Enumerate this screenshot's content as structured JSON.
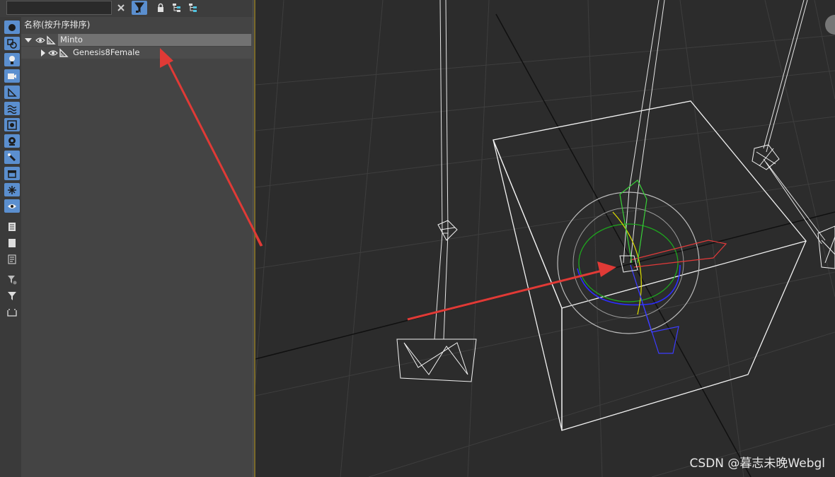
{
  "outliner": {
    "column_header": "名称(按升序排序)",
    "rows": [
      {
        "label": "Minto",
        "expanded": true,
        "selected": true
      },
      {
        "label": "Genesis8Female",
        "expanded": false,
        "selected": false
      }
    ]
  },
  "toolbar": {
    "search_value": "",
    "clear_icon": "close-icon",
    "filter_icon": "filter-icon",
    "lock_icon": "lock-icon",
    "hierarchy_icon": "hierarchy-icon"
  },
  "watermark": "CSDN @暮志未晚Webgl",
  "colors": {
    "accent": "#5b8fcf",
    "arrow": "#e03a36",
    "panel": "#444444",
    "viewport": "#2c2c2c"
  }
}
